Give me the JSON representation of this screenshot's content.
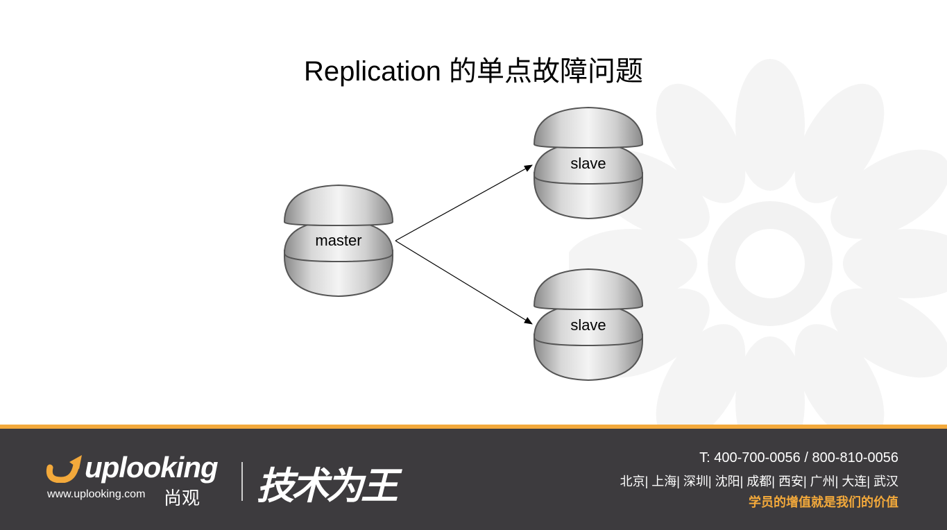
{
  "slide": {
    "title": "Replication 的单点故障问题"
  },
  "diagram": {
    "nodes": [
      {
        "id": "master",
        "label": "master"
      },
      {
        "id": "slave1",
        "label": "slave"
      },
      {
        "id": "slave2",
        "label": "slave"
      }
    ],
    "edges": [
      {
        "from": "master",
        "to": "slave1"
      },
      {
        "from": "master",
        "to": "slave2"
      }
    ]
  },
  "footer": {
    "logo_text": "uplooking",
    "logo_url": "www.uplooking.com",
    "logo_cn": "尚观",
    "slogan": "技术为王",
    "phone": "T: 400-700-0056 / 800-810-0056",
    "cities": "北京| 上海| 深圳| 沈阳| 成都| 西安| 广州| 大连| 武汉",
    "tagline": "学员的增值就是我们的价值",
    "colors": {
      "bar": "#3d3b3e",
      "accent": "#f3a93b"
    }
  }
}
